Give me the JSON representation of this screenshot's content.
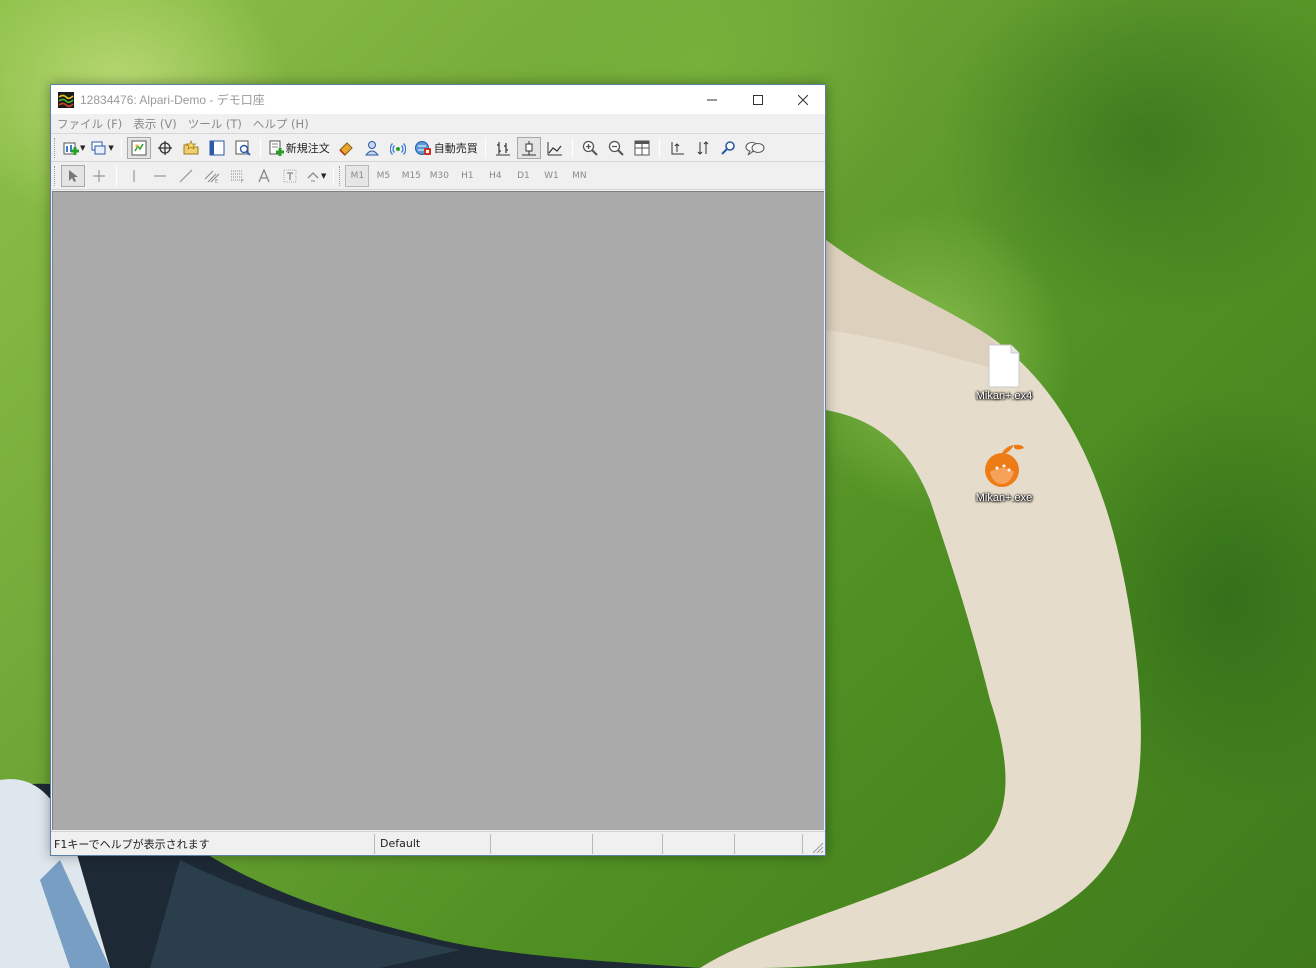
{
  "window": {
    "title": "12834476: Alpari-Demo - デモ口座",
    "controls": {
      "minimize": "minimize",
      "maximize": "maximize",
      "close": "close"
    }
  },
  "menu": {
    "items": [
      "ファイル (F)",
      "表示 (V)",
      "ツール (T)",
      "ヘルプ (H)"
    ]
  },
  "toolbar": {
    "new_order_label": "新規注文",
    "auto_trading_label": "自動売買"
  },
  "timeframes": [
    "M1",
    "M5",
    "M15",
    "M30",
    "H1",
    "H4",
    "D1",
    "W1",
    "MN"
  ],
  "status_bar": {
    "help_text": "F1キーでヘルプが表示されます",
    "profile": "Default",
    "cells": [
      "",
      "",
      "",
      ""
    ]
  },
  "desktop": {
    "icons": [
      {
        "label": "Mikan+.ex4",
        "icon": "file-icon"
      },
      {
        "label": "Mikan+.exe",
        "icon": "orange-app-icon"
      }
    ]
  },
  "colors": {
    "workspace": "#aaaaaa",
    "window_chrome": "#f0f0f0",
    "orange_icon": "#ee7c16"
  }
}
